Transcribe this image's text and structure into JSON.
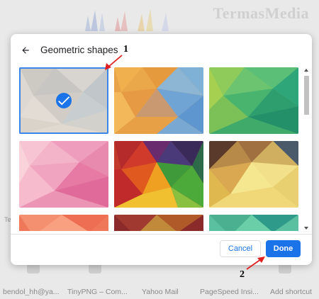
{
  "background": {
    "watermark": "TermasMedia",
    "shortcuts": [
      "bendol_hh@ya...",
      "TinyPNG – Com...",
      "Yahoo Mail",
      "PageSpeed Insi...",
      "Add shortcut"
    ],
    "side_text": "Te"
  },
  "dialog": {
    "title": "Geometric shapes",
    "back_icon": "arrow-back-icon",
    "tiles": [
      {
        "name": "tile-beige",
        "selected": true
      },
      {
        "name": "tile-orange-blue",
        "selected": false
      },
      {
        "name": "tile-green",
        "selected": false
      },
      {
        "name": "tile-pink",
        "selected": false
      },
      {
        "name": "tile-rainbow",
        "selected": false
      },
      {
        "name": "tile-yellow",
        "selected": false
      }
    ],
    "cancel_label": "Cancel",
    "done_label": "Done"
  },
  "annotations": {
    "label_1": "1",
    "label_2": "2"
  },
  "colors": {
    "accent": "#1a73e8",
    "annotation": "#e02020"
  }
}
